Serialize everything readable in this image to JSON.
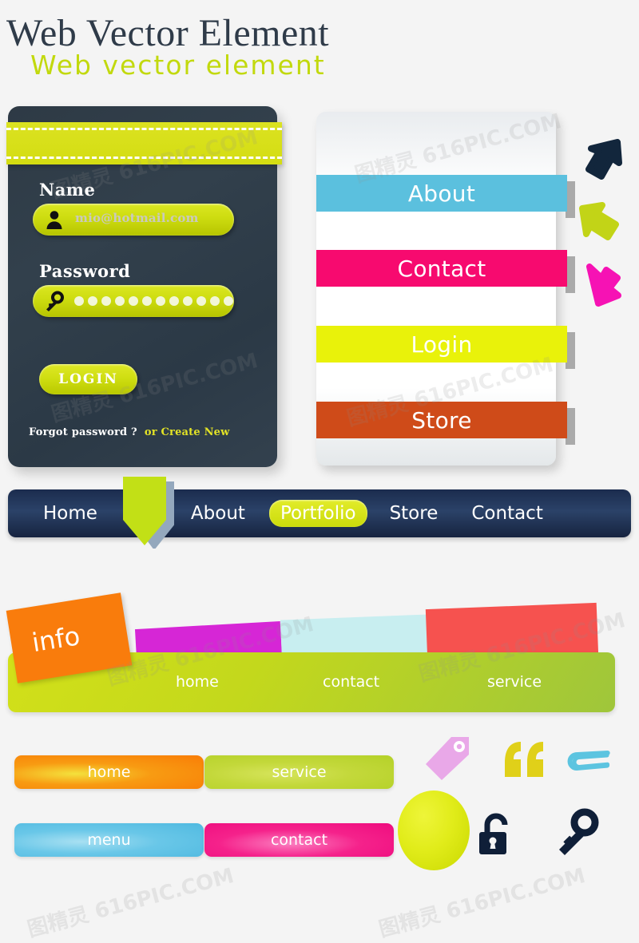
{
  "heading": {
    "title": "Web Vector Element",
    "subtitle": "Web vector element"
  },
  "login_card": {
    "name_label": "Name",
    "name_value": "mio@hotmail.com",
    "password_label": "Password",
    "password_dots": 12,
    "login_button": "LOGIN",
    "forgot_text": "Forgot password ?",
    "create_link": "or Create New",
    "colors": {
      "card_bg": "#2e3a45",
      "ribbon": "#d4dd12",
      "input": "#cddc10",
      "create_link": "#e3e326"
    }
  },
  "ribbon_menu": {
    "items": [
      {
        "label": "About",
        "color": "#5bc0de"
      },
      {
        "label": "Contact",
        "color": "#f70a6f"
      },
      {
        "label": "Login",
        "color": "#e9f20a"
      },
      {
        "label": "Store",
        "color": "#cf4b19"
      }
    ],
    "arrows": [
      {
        "name": "arrow-up-right-dark",
        "color": "#12263c"
      },
      {
        "name": "arrow-up-left-lime",
        "color": "#c2d417"
      },
      {
        "name": "arrow-down-right-pink",
        "color": "#f612b4"
      }
    ]
  },
  "navbar": {
    "items": [
      {
        "label": "Home",
        "active": false
      },
      {
        "label": "About",
        "active": false
      },
      {
        "label": "Portfolio",
        "active": true
      },
      {
        "label": "Store",
        "active": false
      },
      {
        "label": "Contact",
        "active": false
      }
    ],
    "bar_color": "#1b2c4e",
    "active_color": "#cbdb0b",
    "pointer_color": "#c2e016"
  },
  "green_bar": {
    "info_tab": "info",
    "labels": [
      "home",
      "contact",
      "service"
    ],
    "bar_color": "#c3d81c",
    "tabs": [
      {
        "name": "tab-orange-info",
        "color": "#f97c0c"
      },
      {
        "name": "tab-magenta",
        "color": "#d626d6"
      },
      {
        "name": "tab-cyan",
        "color": "#c8eef0"
      },
      {
        "name": "tab-red",
        "color": "#f6524f"
      }
    ]
  },
  "pill_buttons": [
    {
      "label": "home",
      "color": "#f97c06"
    },
    {
      "label": "service",
      "color": "#b4d128"
    },
    {
      "label": "menu",
      "color": "#4fb9e0"
    },
    {
      "label": "contact",
      "color": "#ee0b7e"
    }
  ],
  "icons": [
    {
      "name": "tag-icon",
      "color": "#e9a8e8"
    },
    {
      "name": "quote-icon",
      "color": "#e0d019"
    },
    {
      "name": "paperclip-icon",
      "color": "#5cc4e0"
    },
    {
      "name": "sphere-icon",
      "color": "#e1ec1a"
    },
    {
      "name": "unlock-icon",
      "color": "#0f1f38"
    },
    {
      "name": "key-icon",
      "color": "#0f1f38"
    }
  ],
  "watermarks": [
    "图精灵 616PIC.COM",
    "图精灵 616PIC.COM",
    "图精灵 616PIC.COM",
    "图精灵 616PIC.COM",
    "图精灵 616PIC.COM",
    "图精灵 616PIC.COM"
  ]
}
